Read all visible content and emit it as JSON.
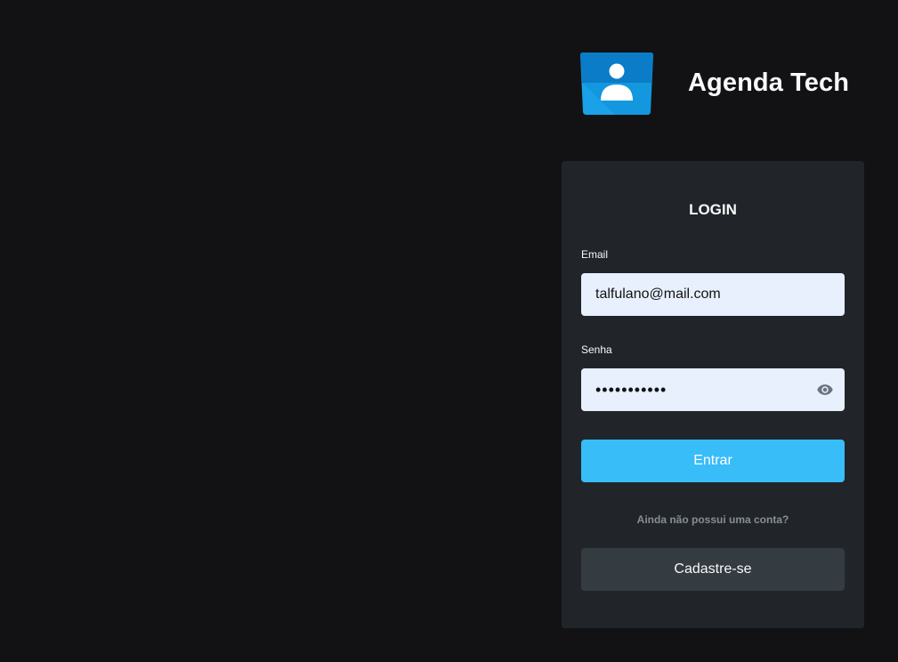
{
  "brand": {
    "title": "Agenda Tech",
    "logo_icon": "contact-card-icon",
    "logo_colors": {
      "top": "#0b7cc7",
      "bottom": "#1aa1e8",
      "figure": "#ffffff"
    }
  },
  "login_form": {
    "title": "LOGIN",
    "email": {
      "label": "Email",
      "value": "talfulano@mail.com",
      "placeholder": ""
    },
    "password": {
      "label": "Senha",
      "value": "•••••••••••",
      "toggle_icon": "eye-icon"
    },
    "submit_label": "Entrar",
    "signup_prompt": "Ainda não possui uma conta?",
    "signup_label": "Cadastre-se"
  },
  "colors": {
    "background": "#121214",
    "card": "#212529",
    "input_background": "#e8f0fe",
    "primary": "#38bdf8",
    "secondary": "#343b41",
    "muted_text": "#868e96",
    "text": "#f8f9fa"
  }
}
